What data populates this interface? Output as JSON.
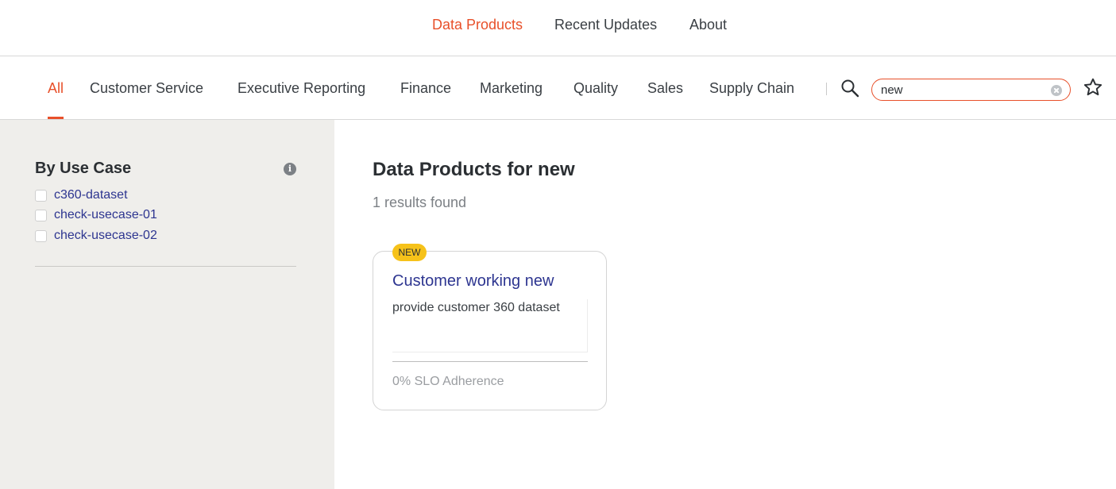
{
  "top_nav": {
    "items": [
      {
        "label": "Data Products",
        "active": true
      },
      {
        "label": "Recent Updates",
        "active": false
      },
      {
        "label": "About",
        "active": false
      }
    ]
  },
  "category_tabs": [
    {
      "label": "All",
      "active": true
    },
    {
      "label": "Customer Service",
      "active": false
    },
    {
      "label": "Executive Reporting",
      "active": false
    },
    {
      "label": "Finance",
      "active": false
    },
    {
      "label": "Marketing",
      "active": false
    },
    {
      "label": "Quality",
      "active": false
    },
    {
      "label": "Sales",
      "active": false
    },
    {
      "label": "Supply Chain",
      "active": false
    }
  ],
  "search": {
    "value": "new",
    "icons": [
      "search-icon",
      "clear-icon",
      "star-icon"
    ]
  },
  "sidebar": {
    "title": "By Use Case",
    "info_icon": "i",
    "use_cases": [
      {
        "label": "c360-dataset",
        "checked": false
      },
      {
        "label": "check-usecase-01",
        "checked": false
      },
      {
        "label": "check-usecase-02",
        "checked": false
      }
    ]
  },
  "results": {
    "title": "Data Products for new",
    "count_text": "1 results found"
  },
  "cards": [
    {
      "badge": "NEW",
      "title": "Customer working new",
      "description": "provide customer 360 dataset",
      "slo": "0% SLO Adherence"
    }
  ],
  "colors": {
    "accent": "#e8502a",
    "link": "#2d3590",
    "badge": "#f6c21a",
    "sidebar_bg": "#efeeeb"
  }
}
